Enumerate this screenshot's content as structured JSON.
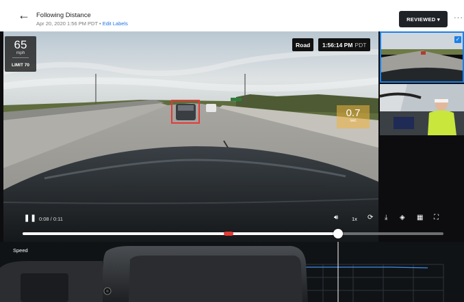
{
  "header": {
    "back_icon": "arrow-left-icon",
    "title": "Following Distance",
    "subtitle": "Apr 20, 2020 1:56 PM PDT •",
    "edit_link": "Edit Labels",
    "reviewed_label": "REVIEWED ▾",
    "more_label": "···"
  },
  "video": {
    "speed": "65",
    "speed_unit": "mph",
    "speed_limit": "LIMIT 70",
    "source_label": "Road",
    "timestamp": "1:56:14 PM",
    "timezone": "PDT",
    "following_gap": "0.7",
    "following_gap_unit": "sec",
    "accent": "#1c80e8"
  },
  "controls": {
    "play_icon": "pause-icon",
    "time": "0:08 / 0:11",
    "rate": "1x",
    "progress_fraction": 0.75,
    "event_marker_fraction": 0.49
  },
  "chart": {
    "label": "Speed"
  }
}
